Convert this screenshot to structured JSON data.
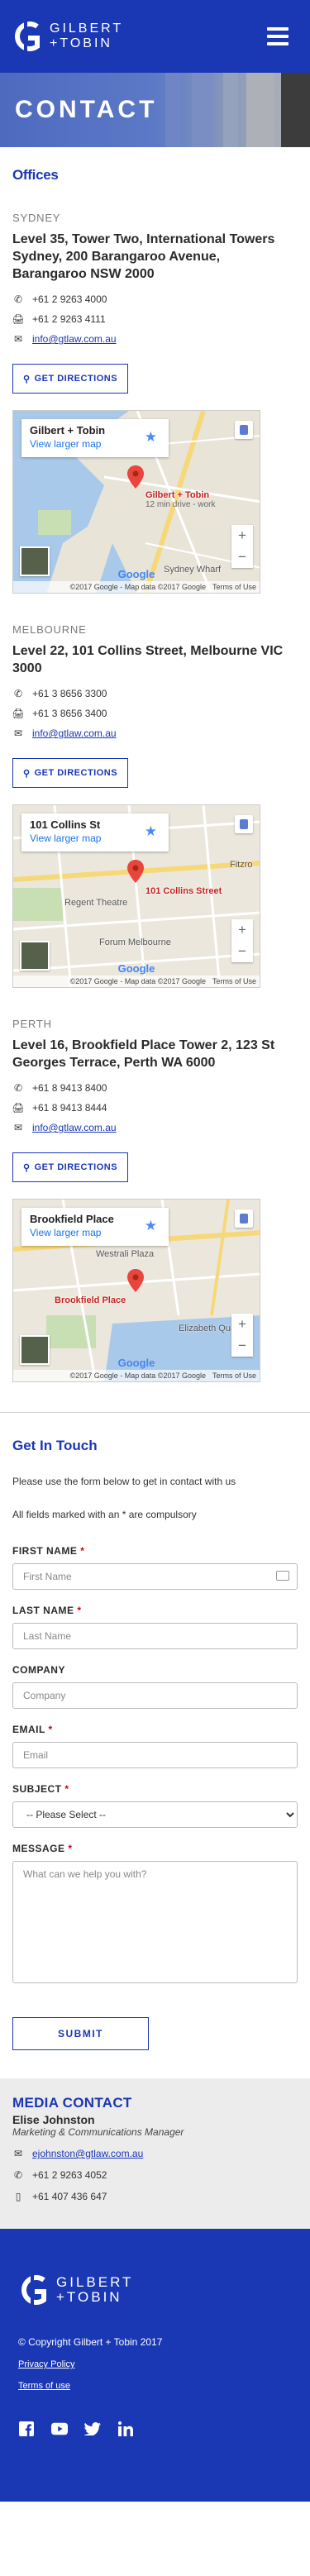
{
  "header": {
    "logo_line1": "GILBERT",
    "logo_line2": "+TOBIN"
  },
  "banner": {
    "title": "CONTACT"
  },
  "offices": {
    "title": "Offices",
    "directions_label": "GET DIRECTIONS",
    "map_larger_label": "View larger map",
    "map_footer_data": "©2017 Google - Map data ©2017 Google",
    "map_footer_terms": "Terms of Use",
    "map_google": "Google",
    "items": [
      {
        "city": "SYDNEY",
        "address": "Level 35, Tower Two, International Towers Sydney, 200 Barangaroo Avenue, Barangaroo NSW 2000",
        "phone": "+61 2 9263 4000",
        "fax": "+61 2 9263 4111",
        "email": "info@gtlaw.com.au",
        "map_card_name": "Gilbert + Tobin",
        "pin_label": "Gilbert + Tobin",
        "pin_sub": "12 min drive - work",
        "map_label": "Sydney Wharf"
      },
      {
        "city": "MELBOURNE",
        "address": "Level 22, 101 Collins Street, Melbourne VIC 3000",
        "phone": "+61 3 8656 3300",
        "fax": "+61 3 8656 3400",
        "email": "info@gtlaw.com.au",
        "map_card_name": "101 Collins St",
        "pin_label": "101 Collins Street",
        "pin_sub": "",
        "map_label": "Regent Theatre",
        "map_label2": "Forum Melbourne",
        "map_label3": "Fitzro"
      },
      {
        "city": "PERTH",
        "address": "Level 16, Brookfield Place Tower 2, 123 St Georges Terrace, Perth WA 6000",
        "phone": "+61 8 9413 8400",
        "fax": "+61 8 9413 8444",
        "email": "info@gtlaw.com.au",
        "map_card_name": "Brookfield Place",
        "pin_label": "Brookfield Place",
        "pin_sub": "",
        "map_label": "Elizabeth Quay",
        "map_label2": "Westrali Plaza"
      }
    ]
  },
  "contact_form": {
    "title": "Get In Touch",
    "intro": "Please use the form below to get in contact with us",
    "note": "All fields marked with an * are compulsory",
    "first_name": {
      "label": "FIRST NAME",
      "placeholder": "First Name",
      "required": "*"
    },
    "last_name": {
      "label": "LAST NAME",
      "placeholder": "Last Name",
      "required": "*"
    },
    "company": {
      "label": "COMPANY",
      "placeholder": "Company"
    },
    "email": {
      "label": "EMAIL",
      "placeholder": "Email",
      "required": "*"
    },
    "subject": {
      "label": "SUBJECT",
      "selected": "-- Please Select --",
      "required": "*"
    },
    "message": {
      "label": "MESSAGE",
      "placeholder": "What can we help you with?",
      "required": "*"
    },
    "submit_label": "SUBMIT"
  },
  "media_contact": {
    "title": "MEDIA CONTACT",
    "name": "Elise Johnston",
    "role": "Marketing & Communications Manager",
    "email": "ejohnston@gtlaw.com.au",
    "phone": "+61 2 9263 4052",
    "mobile": "+61 407 436 647"
  },
  "footer": {
    "logo_line1": "GILBERT",
    "logo_line2": "+TOBIN",
    "copyright": "© Copyright Gilbert + Tobin 2017",
    "privacy_label": "Privacy Policy",
    "terms_label": "Terms of use",
    "socials": [
      "facebook-icon",
      "youtube-icon",
      "twitter-icon",
      "linkedin-icon"
    ]
  },
  "colors": {
    "brand_blue": "#1a37b4",
    "link_blue": "#1a73e8",
    "required_red": "#cc0000",
    "pin_red": "#c5221f"
  }
}
